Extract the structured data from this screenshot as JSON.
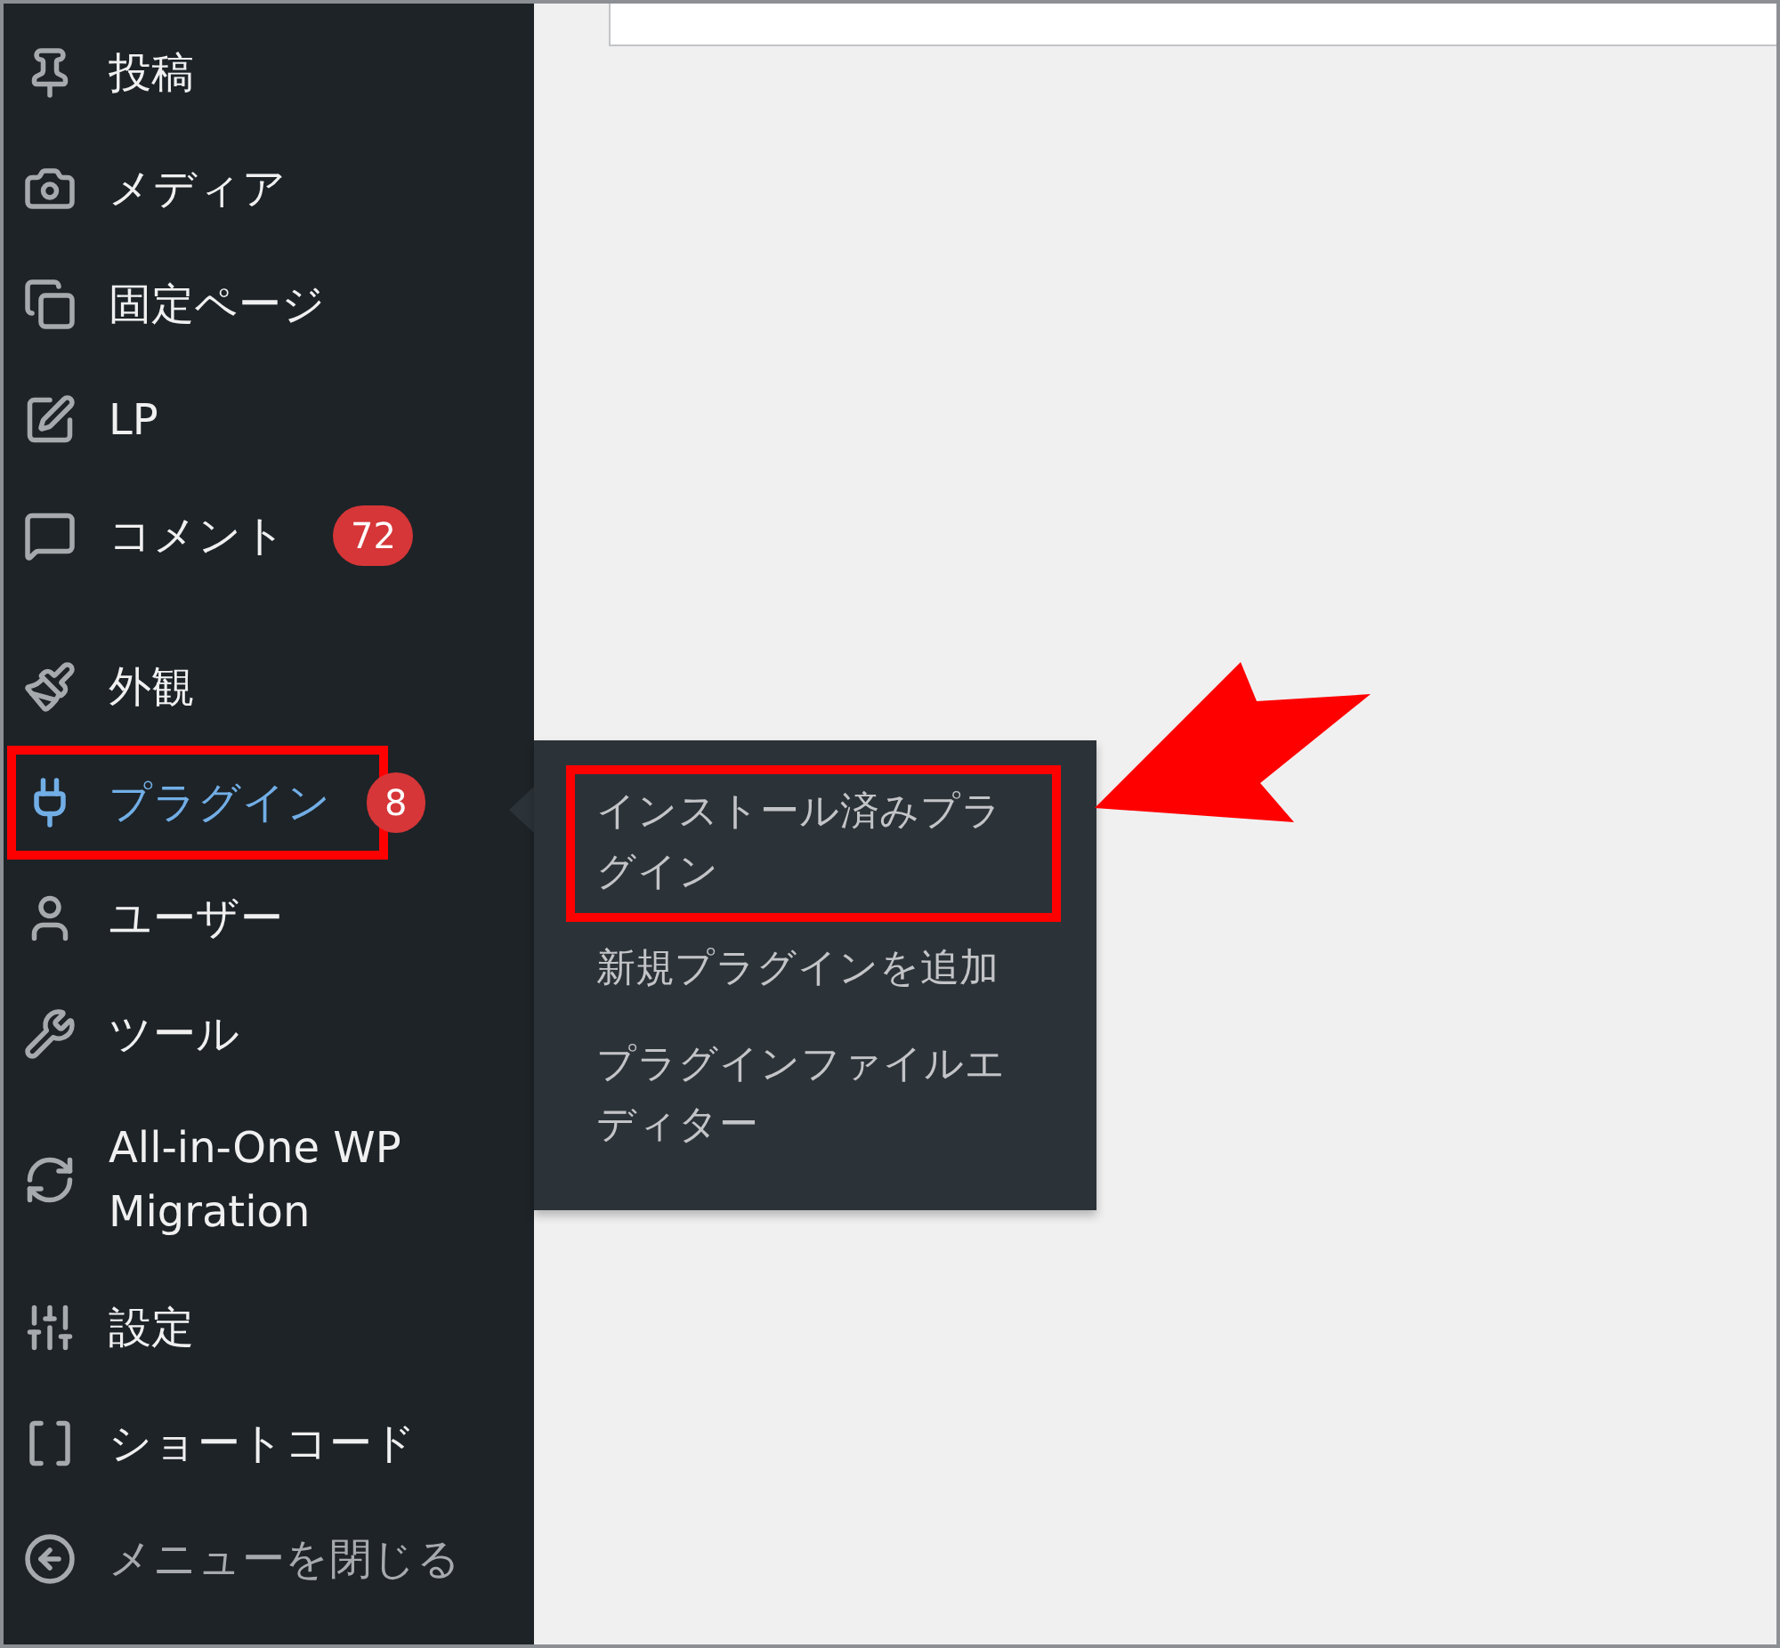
{
  "menu": [
    {
      "kind": "item",
      "label": "投稿",
      "selected": false,
      "highlighted": false,
      "dimmed": false
    },
    {
      "kind": "item",
      "label": "メディア",
      "selected": false,
      "highlighted": false,
      "dimmed": false
    },
    {
      "kind": "item",
      "label": "固定ページ",
      "selected": false,
      "highlighted": false,
      "dimmed": false
    },
    {
      "kind": "item",
      "label": "LP",
      "selected": false,
      "highlighted": false,
      "dimmed": false
    },
    {
      "kind": "item",
      "label": "コメント",
      "badge": "72",
      "selected": false,
      "highlighted": false,
      "dimmed": false
    },
    {
      "kind": "separator"
    },
    {
      "kind": "item",
      "label": "外観",
      "selected": false,
      "highlighted": false,
      "dimmed": false
    },
    {
      "kind": "item",
      "label": "プラグイン",
      "badge": "8",
      "selected": true,
      "highlighted": true,
      "dimmed": false,
      "submenu": [
        {
          "label": "インストール済みプラグイン",
          "highlighted": true
        },
        {
          "label": "新規プラグインを追加",
          "highlighted": false
        },
        {
          "label": "プラグインファイルエディター",
          "highlighted": false
        }
      ]
    },
    {
      "kind": "item",
      "label": "ユーザー",
      "selected": false,
      "highlighted": false,
      "dimmed": false
    },
    {
      "kind": "item",
      "label": "ツール",
      "selected": false,
      "highlighted": false,
      "dimmed": false
    },
    {
      "kind": "item",
      "label": "All-in-One WP Migration",
      "selected": false,
      "highlighted": false,
      "dimmed": false
    },
    {
      "kind": "item",
      "label": "設定",
      "selected": false,
      "highlighted": false,
      "dimmed": false
    },
    {
      "kind": "item",
      "label": "ショートコード",
      "selected": false,
      "highlighted": false,
      "dimmed": false
    },
    {
      "kind": "item",
      "label": "メニューを閉じる",
      "selected": false,
      "highlighted": false,
      "dimmed": true
    }
  ]
}
